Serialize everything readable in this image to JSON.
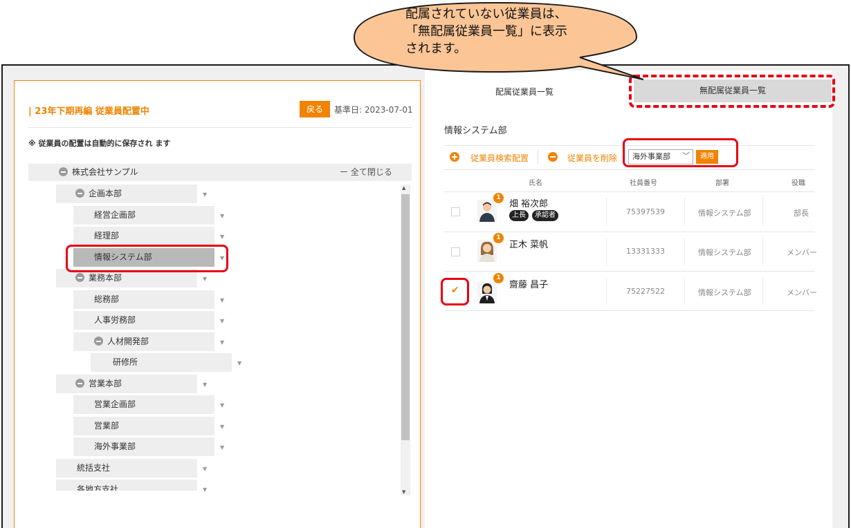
{
  "callout": {
    "line1": "配属されていない従業員は、",
    "line2": "「無配属従業員一覧」に表示",
    "line3": "されます。"
  },
  "left": {
    "title": "| 23年下期再編 従業員配置中",
    "back_label": "戻る",
    "base_date": "基準日: 2023-07-01",
    "autosave_note": "※ 従業員の配置は自動的に保存され ます",
    "root_label": "株式会社サンプル",
    "collapse_all": "ー 全て閉じる",
    "tree": [
      {
        "label": "企画本部"
      },
      {
        "label": "経営企画部"
      },
      {
        "label": "経理部"
      },
      {
        "label": "情報システム部"
      },
      {
        "label": "業務本部"
      },
      {
        "label": "総務部"
      },
      {
        "label": "人事労務部"
      },
      {
        "label": "人材開発部"
      },
      {
        "label": "研修所"
      },
      {
        "label": "営業本部"
      },
      {
        "label": "営業企画部"
      },
      {
        "label": "営業部"
      },
      {
        "label": "海外事業部"
      },
      {
        "label": "統括支社"
      },
      {
        "label": "各地方支社"
      }
    ]
  },
  "right": {
    "tab_assigned": "配属従業員一覧",
    "tab_unassigned": "無配属従業員一覧",
    "department": "情報システム部",
    "search_assign": "従業員検索配置",
    "remove_employee": "従業員を削除",
    "select_value": "海外事業部",
    "apply_label": "適用",
    "columns": {
      "name": "氏名",
      "emp_no": "社員番号",
      "dept": "部署",
      "role": "役職"
    },
    "employees": [
      {
        "badge": "1",
        "name": "畑 裕次郎",
        "tags": [
          "上長",
          "承認者"
        ],
        "emp_no": "75397539",
        "dept": "情報システム部",
        "role": "部長",
        "checked": false
      },
      {
        "badge": "1",
        "name": "正木 菜帆",
        "tags": [],
        "emp_no": "13331333",
        "dept": "情報システム部",
        "role": "メンバー",
        "checked": false
      },
      {
        "badge": "1",
        "name": "齋藤 昌子",
        "tags": [],
        "emp_no": "75227522",
        "dept": "情報システム部",
        "role": "メンバー",
        "checked": true
      }
    ]
  },
  "colors": {
    "accent": "#f08300",
    "highlight": "#e60012"
  }
}
